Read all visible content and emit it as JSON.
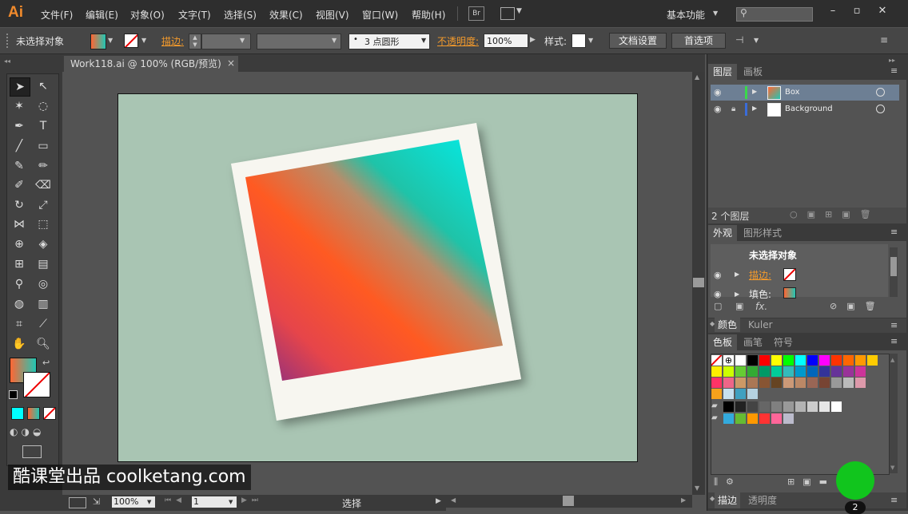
{
  "app": {
    "logo": "Ai",
    "workspace": "基本功能",
    "br": "Br"
  },
  "menu": [
    "文件(F)",
    "编辑(E)",
    "对象(O)",
    "文字(T)",
    "选择(S)",
    "效果(C)",
    "视图(V)",
    "窗口(W)",
    "帮助(H)"
  ],
  "control": {
    "selection": "未选择对象",
    "stroke_label": "描边:",
    "brush_label": "3 点圆形",
    "opacity_label": "不透明度:",
    "opacity_value": "100%",
    "style_label": "样式:",
    "doc_setup": "文档设置",
    "prefs": "首选项"
  },
  "document": {
    "tab_title": "Work118.ai @ 100% (RGB/预览)",
    "close": "×"
  },
  "status": {
    "zoom": "100%",
    "page": "1",
    "tool": "选择"
  },
  "layers": {
    "tabs": [
      "图层",
      "画板"
    ],
    "items": [
      {
        "name": "Box"
      },
      {
        "name": "Background"
      }
    ],
    "count": "2 个图层"
  },
  "appearance": {
    "tabs": [
      "外观",
      "图形样式"
    ],
    "title": "未选择对象",
    "stroke": "描边:",
    "fill": "填色:",
    "fx": "fx."
  },
  "color": {
    "tabs": [
      "颜色",
      "Kuler"
    ]
  },
  "swatches": {
    "tabs": [
      "色板",
      "画笔",
      "符号"
    ],
    "colors_row1": [
      "#ffffff",
      "#000000",
      "#ff0000",
      "#ffff00",
      "#00ff00",
      "#00ffff",
      "#0000ff",
      "#ff00ff",
      "#ff3300",
      "#ff6600",
      "#ff9900",
      "#ffcc00"
    ],
    "colors_row2": [
      "#ffee00",
      "#ccff00",
      "#66cc33",
      "#33aa33",
      "#009966",
      "#00cc99",
      "#33bbbb",
      "#0099cc",
      "#0066bb",
      "#333399",
      "#663399",
      "#993399",
      "#cc3399"
    ],
    "colors_row3": [
      "#ff3366",
      "#ee6688",
      "#cc9966",
      "#aa7755",
      "#885533",
      "#664422",
      "#cc9977",
      "#bb8866",
      "#996655",
      "#774433",
      "#999999",
      "#bbbbbb",
      "#dd99aa"
    ],
    "gray_row": [
      "#000000",
      "#222222",
      "#444444",
      "#666666",
      "#808080",
      "#999999",
      "#b3b3b3",
      "#cccccc",
      "#e6e6e6",
      "#ffffff"
    ],
    "group_row": [
      "#33aadd",
      "#66bb33",
      "#ff9900",
      "#ff3333",
      "#ff6699",
      "#bbbbcc"
    ]
  },
  "bottom_tabs": [
    "描边",
    "透明度"
  ],
  "watermark": "酷课堂出品 coolketang.com",
  "badge": "2"
}
